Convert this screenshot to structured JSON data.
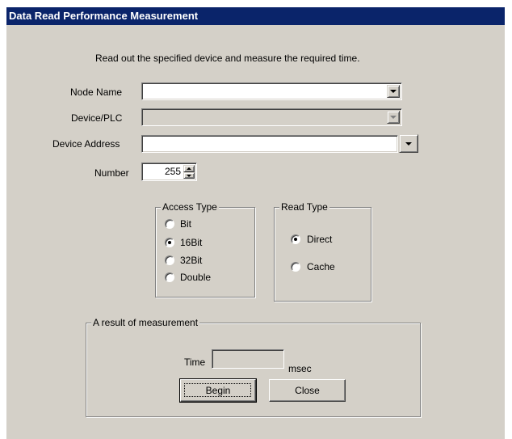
{
  "dialog": {
    "title": "Data Read Performance Measurement",
    "description": "Read out the specified device and measure the required time."
  },
  "form": {
    "node_name_label": "Node Name",
    "node_name_value": "",
    "device_plc_label": "Device/PLC",
    "device_plc_value": "",
    "device_address_label": "Device Address",
    "device_address_value": "",
    "number_label": "Number",
    "number_value": "255"
  },
  "access_type": {
    "title": "Access Type",
    "options": [
      "Bit",
      "16Bit",
      "32Bit",
      "Double"
    ],
    "selected": "16Bit"
  },
  "read_type": {
    "title": "Read Type",
    "options": [
      "Direct",
      "Cache"
    ],
    "selected": "Direct"
  },
  "result": {
    "title": "A result of measurement",
    "time_label": "Time",
    "time_value": "",
    "unit": "msec"
  },
  "buttons": {
    "begin": "Begin",
    "close": "Close"
  },
  "colors": {
    "titlebar": "#0a246a",
    "face": "#d4d0c8"
  }
}
